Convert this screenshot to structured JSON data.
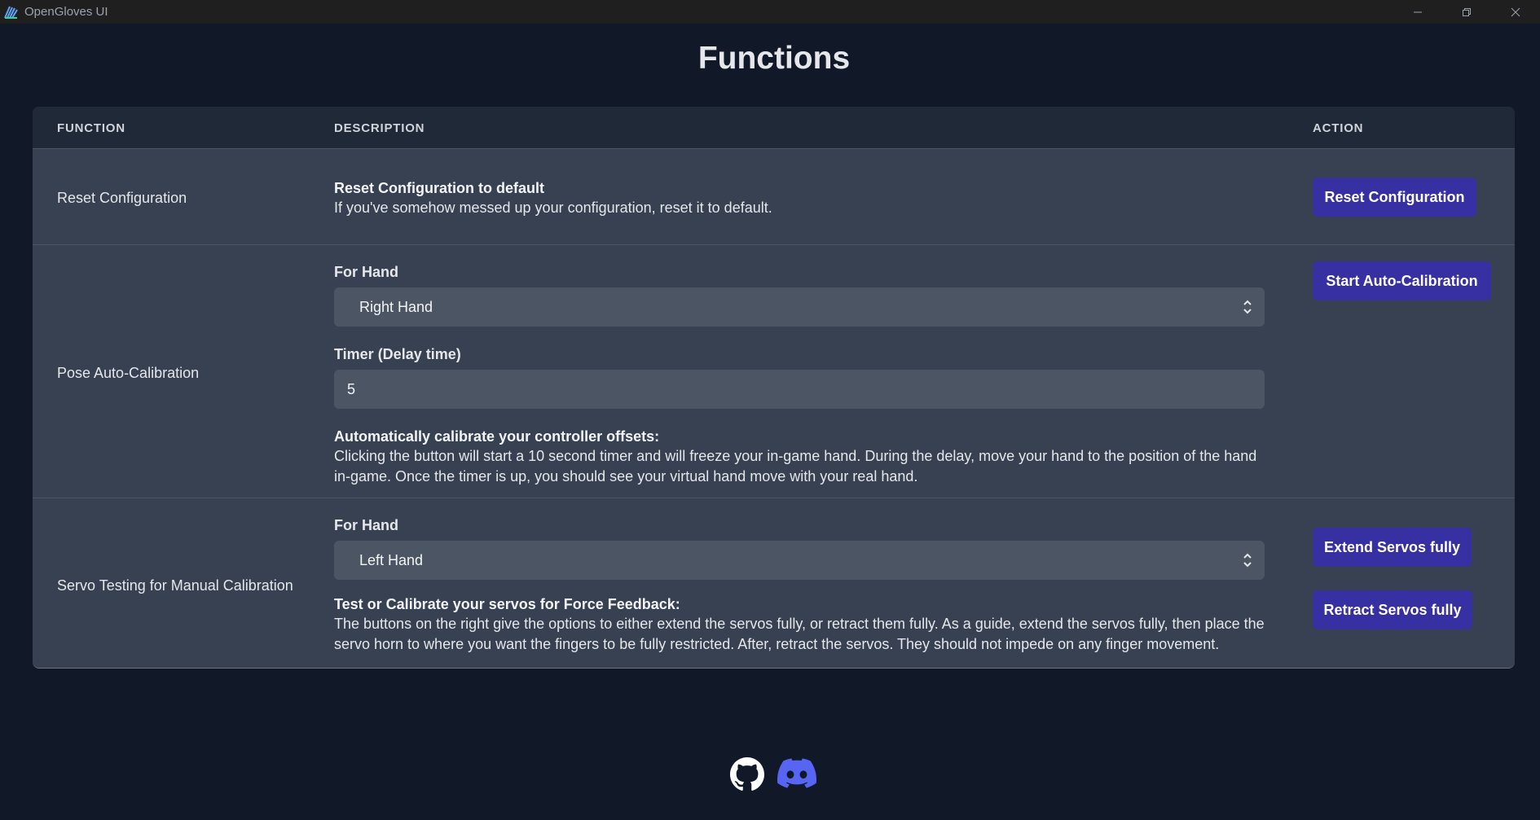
{
  "window": {
    "title": "OpenGloves UI"
  },
  "page": {
    "title": "Functions"
  },
  "table": {
    "headers": {
      "function": "FUNCTION",
      "description": "DESCRIPTION",
      "action": "ACTION"
    },
    "rows": [
      {
        "name": "Reset Configuration",
        "desc_bold": "Reset Configuration to default",
        "desc_text": "If you've somehow messed up your configuration, reset it to default.",
        "button": "Reset Configuration"
      },
      {
        "name": "Pose Auto-Calibration",
        "hand_label": "For Hand",
        "hand_value": "Right Hand",
        "timer_label": "Timer (Delay time)",
        "timer_value": "5",
        "desc_bold": "Automatically calibrate your controller offsets:",
        "desc_text": "Clicking the button will start a 10 second timer and will freeze your in-game hand. During the delay, move your hand to the position of the hand in-game. Once the timer is up, you should see your virtual hand move with your real hand.",
        "button": "Start Auto-Calibration"
      },
      {
        "name": "Servo Testing for Manual Calibration",
        "hand_label": "For Hand",
        "hand_value": "Left Hand",
        "desc_bold": "Test or Calibrate your servos for Force Feedback:",
        "desc_text": "The buttons on the right give the options to either extend the servos fully, or retract them fully. As a guide, extend the servos fully, then place the servo horn to where you want the fingers to be fully restricted. After, retract the servos. They should not impede on any finger movement.",
        "button_extend": "Extend Servos fully",
        "button_retract": "Retract Servos fully"
      }
    ]
  },
  "footer": {
    "icons": [
      "github-icon",
      "discord-icon"
    ]
  },
  "colors": {
    "background": "#111827",
    "card": "#374151",
    "button": "#3730a3",
    "discord": "#5865f2"
  }
}
